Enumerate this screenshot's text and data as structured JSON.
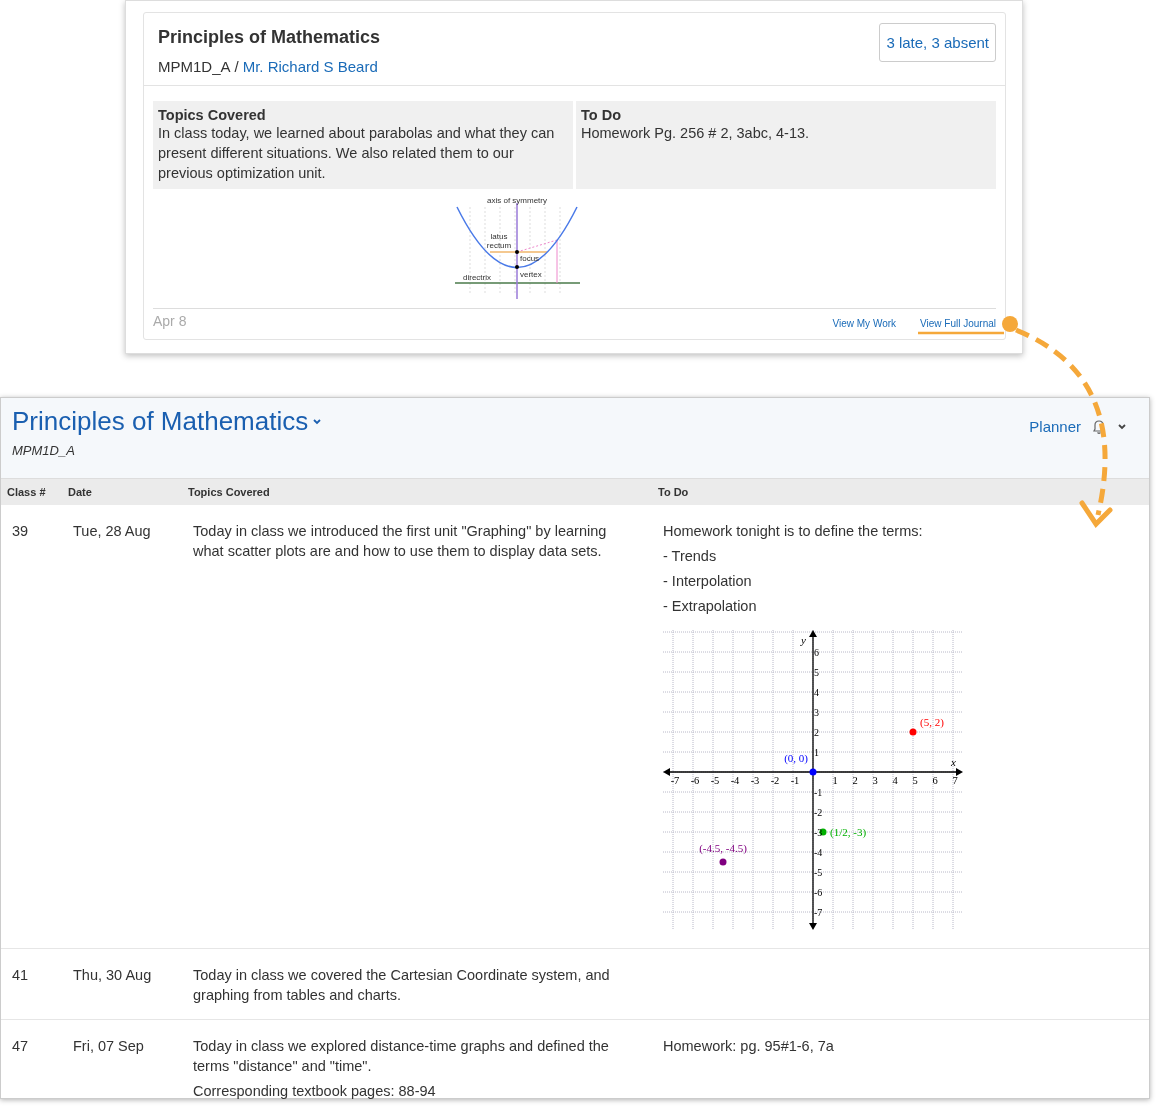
{
  "journal_card": {
    "title": "Principles of Mathematics",
    "course_code": "MPM1D_A",
    "separator": "/",
    "teacher": "Mr. Richard S Beard",
    "attendance_button": "3 late, 3 absent",
    "sections": [
      {
        "heading": "Topics Covered",
        "body": "In class today, we learned about parabolas and what they can present different situations. We also related them to our previous optimization unit."
      },
      {
        "heading": "To Do",
        "body": "Homework Pg. 256 # 2, 3abc, 4-13."
      }
    ],
    "diagram": {
      "labels": [
        "axis of symmetry",
        "latus",
        "rectum",
        "focus",
        "vertex",
        "directrix"
      ]
    },
    "date": "Apr 8",
    "links": [
      "View My Work",
      "View Full Journal"
    ]
  },
  "journal": {
    "title": "Principles of Mathematics",
    "course_code": "MPM1D_A",
    "planner_link": "Planner",
    "columns": [
      "Class #",
      "Date",
      "Topics Covered",
      "To Do"
    ],
    "rows": [
      {
        "class_no": "39",
        "date": "Tue, 28 Aug",
        "topics": [
          "Today in class we introduced the first unit \"Graphing\" by learning what scatter plots are and how to use them to display data sets."
        ],
        "todo": [
          "Homework tonight is to define the terms:",
          "- Trends",
          "- Interpolation",
          "- Extrapolation"
        ],
        "chart_data": {
          "type": "scatter",
          "grid": true,
          "xlabel": "x",
          "ylabel": "y",
          "x": [
            0,
            5,
            0.5,
            -4.5
          ],
          "xlim": [
            -7.5,
            7.5
          ],
          "ylim": [
            -7.9,
            7.1
          ],
          "xticks": [
            -7,
            -6,
            -5,
            -4,
            -3,
            -2,
            -1,
            1,
            2,
            3,
            4,
            5,
            6,
            7
          ],
          "yticks": [
            -7,
            -6,
            -5,
            -4,
            -3,
            -2,
            -1,
            1,
            2,
            3,
            4,
            5,
            6
          ],
          "series": [
            {
              "name": "(0, 0)",
              "color": "#0000ff",
              "values": [
                0,
                null,
                null,
                null
              ]
            },
            {
              "name": "(5, 2)",
              "color": "#ff0000",
              "values": [
                null,
                2,
                null,
                null
              ]
            },
            {
              "name": "(1/2, -3)",
              "color": "#00b000",
              "values": [
                null,
                null,
                -3,
                null
              ]
            },
            {
              "name": "(-4.5, -4.5)",
              "color": "#800080",
              "values": [
                null,
                null,
                null,
                -4.5
              ]
            }
          ]
        }
      },
      {
        "class_no": "41",
        "date": "Thu, 30 Aug",
        "topics": [
          "Today in class we covered the Cartesian Coordinate system, and graphing from tables and charts."
        ]
      },
      {
        "class_no": "47",
        "date": "Fri, 07 Sep",
        "topics": [
          "Today in class we explored distance-time graphs and defined the terms \"distance\" and \"time\".",
          "Corresponding textbook pages: 88-94"
        ],
        "todo": [
          "Homework: pg. 95#1-6, 7a"
        ]
      }
    ]
  }
}
